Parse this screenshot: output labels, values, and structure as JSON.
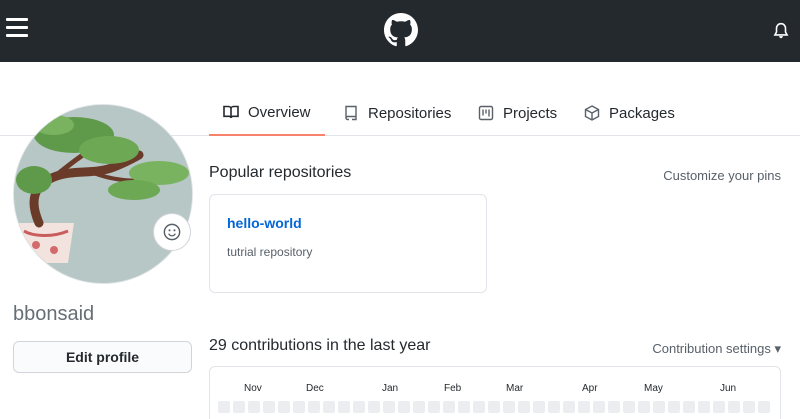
{
  "tabs": [
    {
      "label": "Overview",
      "icon": "book-icon"
    },
    {
      "label": "Repositories",
      "icon": "repo-icon"
    },
    {
      "label": "Projects",
      "icon": "project-icon"
    },
    {
      "label": "Packages",
      "icon": "package-icon"
    }
  ],
  "profile": {
    "username": "bbonsaid",
    "edit_label": "Edit profile"
  },
  "popular": {
    "title": "Popular repositories",
    "customize_label": "Customize your pins",
    "repos": [
      {
        "name": "hello-world",
        "description": "tutrial repository"
      }
    ]
  },
  "contributions": {
    "title": "29 contributions in the last year",
    "settings_label": "Contribution settings ▾",
    "months": [
      "Nov",
      "Dec",
      "Jan",
      "Feb",
      "Mar",
      "Apr",
      "May",
      "Jun"
    ]
  },
  "colors": {
    "header_bg": "#24292e",
    "active_tab": "#f9826c",
    "link": "#0366d6",
    "cell_empty": "#ebedf0"
  }
}
